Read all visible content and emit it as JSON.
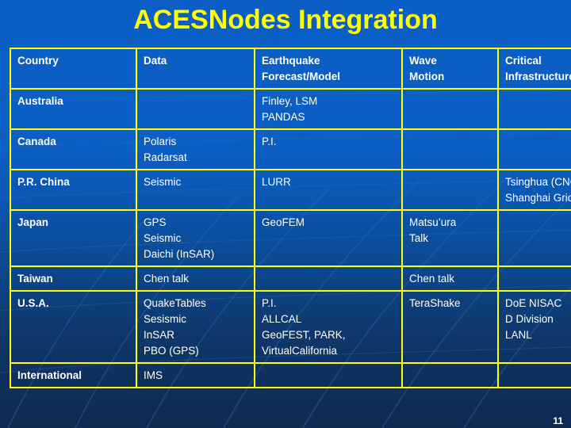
{
  "slide": {
    "title": "ACESNodes Integration",
    "slide_number": "11",
    "colors": {
      "title_text": "#ffff00",
      "table_border": "#ffff00",
      "cell_text": "#ffffff",
      "background_top": "#0b5fc4",
      "background_bottom": "#102a52"
    }
  },
  "table": {
    "headers": [
      "Country",
      "Data",
      "Earthquake Forecast/Model",
      "Wave Motion",
      "Critical Infrastructure"
    ],
    "header_lines": [
      [
        "Country"
      ],
      [
        "Data"
      ],
      [
        "Earthquake",
        "Forecast/Model"
      ],
      [
        "Wave",
        "Motion"
      ],
      [
        "Critical",
        "Infrastructure"
      ]
    ],
    "rows": [
      {
        "country": "Australia",
        "data": [],
        "forecast": [
          "Finley, LSM",
          "PANDAS"
        ],
        "wave": [],
        "infrastructure": []
      },
      {
        "country": "Canada",
        "data": [
          "Polaris",
          "Radarsat"
        ],
        "forecast": [
          "P.I."
        ],
        "wave": [],
        "infrastructure": []
      },
      {
        "country": "P.R. China",
        "data": [
          "Seismic"
        ],
        "forecast": [
          "LURR"
        ],
        "wave": [],
        "infrastructure": [
          "Tsinghua (CNG)",
          "Shanghai Grid"
        ]
      },
      {
        "country": "Japan",
        "data": [
          "GPS",
          "Seismic",
          "Daichi (InSAR)"
        ],
        "forecast": [
          "GeoFEM"
        ],
        "wave": [
          "Matsu’ura",
          "Talk"
        ],
        "infrastructure": []
      },
      {
        "country": "Taiwan",
        "data": [
          "Chen talk"
        ],
        "forecast": [],
        "wave": [
          "Chen talk"
        ],
        "infrastructure": []
      },
      {
        "country": "U.S.A.",
        "data": [
          "QuakeTables",
          "Sesismic",
          "InSAR",
          "PBO (GPS)"
        ],
        "forecast": [
          "P.I.",
          "ALLCAL",
          "GeoFEST, PARK,",
          "VirtualCalifornia"
        ],
        "wave": [
          "TeraShake"
        ],
        "infrastructure": [
          "DoE NISAC",
          "D Division",
          "LANL"
        ]
      },
      {
        "country": "International",
        "data": [
          "IMS"
        ],
        "forecast": [],
        "wave": [],
        "infrastructure": []
      }
    ]
  }
}
